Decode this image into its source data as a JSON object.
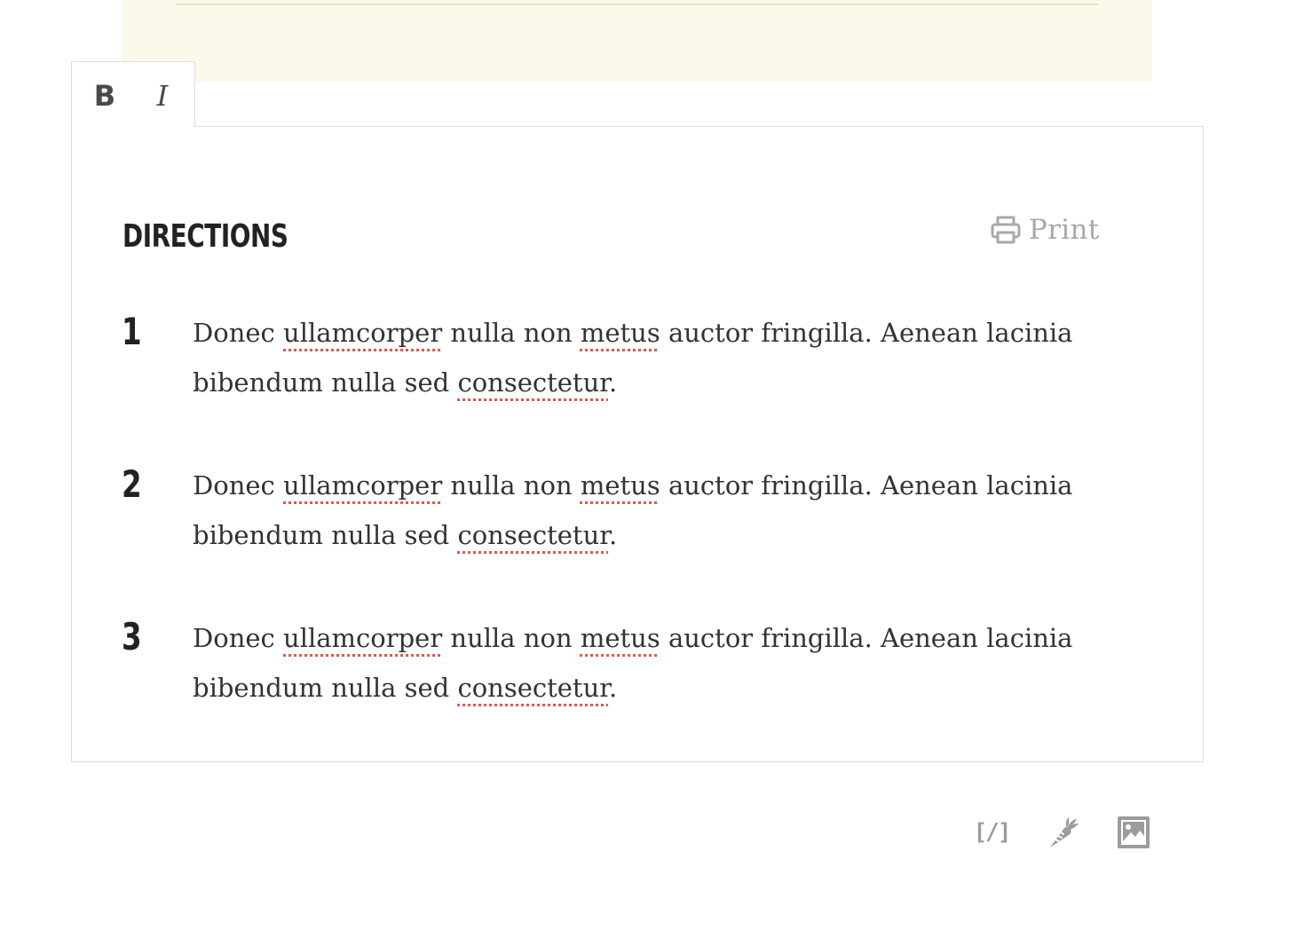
{
  "toolbar": {
    "bold_label": "B",
    "italic_label": "I"
  },
  "directions": {
    "title": "DIRECTIONS",
    "print_label": "Print",
    "steps": [
      {
        "number": "1",
        "parts": [
          "Donec ",
          "ullamcorper",
          " nulla non ",
          "metus",
          " auctor fringilla. Aenean lacinia bibendum nulla sed ",
          "consectetur",
          "."
        ]
      },
      {
        "number": "2",
        "parts": [
          "Donec ",
          "ullamcorper",
          " nulla non ",
          "metus",
          " auctor fringilla. Aenean lacinia bibendum nulla sed ",
          "consectetur",
          "."
        ]
      },
      {
        "number": "3",
        "parts": [
          "Donec ",
          "ullamcorper",
          " nulla non ",
          "metus",
          " auctor fringilla. Aenean lacinia bibendum nulla sed ",
          "consectetur",
          "."
        ]
      }
    ]
  },
  "bottom_tools": {
    "shortcode_label": "[/]",
    "carrot_icon": "carrot-icon",
    "image_icon": "image-icon"
  },
  "colors": {
    "top_panel": "#fbf9ea",
    "spellcheck_underline": "#e0574f",
    "muted_icon": "#9c9c9c"
  }
}
